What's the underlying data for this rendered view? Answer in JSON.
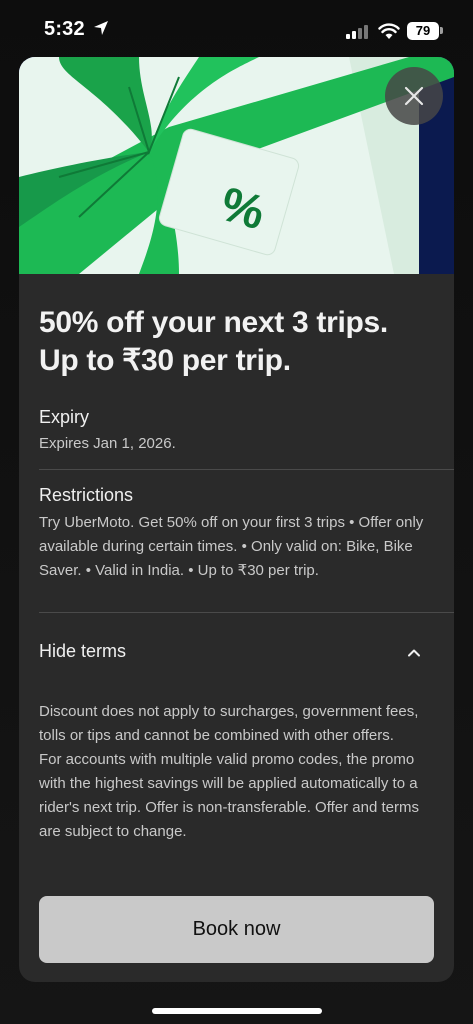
{
  "status_bar": {
    "time": "5:32",
    "battery": "79"
  },
  "offer": {
    "title_line1": "50% off your next 3 trips.",
    "title_line2": "Up to ₹30 per trip.",
    "hero_symbol": "%"
  },
  "expiry": {
    "heading": "Expiry",
    "text": "Expires Jan 1, 2026."
  },
  "restrictions": {
    "heading": "Restrictions",
    "text": "Try UberMoto. Get 50% off on your first 3 trips • Offer only available during certain times. • Only valid on: Bike, Bike Saver. • Valid in India. • Up to ₹30 per trip."
  },
  "terms": {
    "toggle_label": "Hide terms",
    "text_1": "Discount does not apply to surcharges, government fees, tolls or tips and cannot be combined with other offers.",
    "text_2": "For accounts with multiple valid promo codes, the promo with the highest savings will be applied automatically to a rider's next trip. Offer is non-transferable. Offer and terms are subject to change."
  },
  "actions": {
    "book_now": "Book now"
  },
  "icons": {
    "close": "close-icon",
    "chevron": "chevron-up-icon",
    "location": "location-arrow-icon",
    "signal": "cellular-signal-icon",
    "wifi": "wifi-icon"
  },
  "colors": {
    "ribbon_green": "#1db954",
    "hero_bg": "#8d96e0",
    "sheet_bg": "#2a2a2a",
    "button_bg": "#c9c9c9"
  }
}
